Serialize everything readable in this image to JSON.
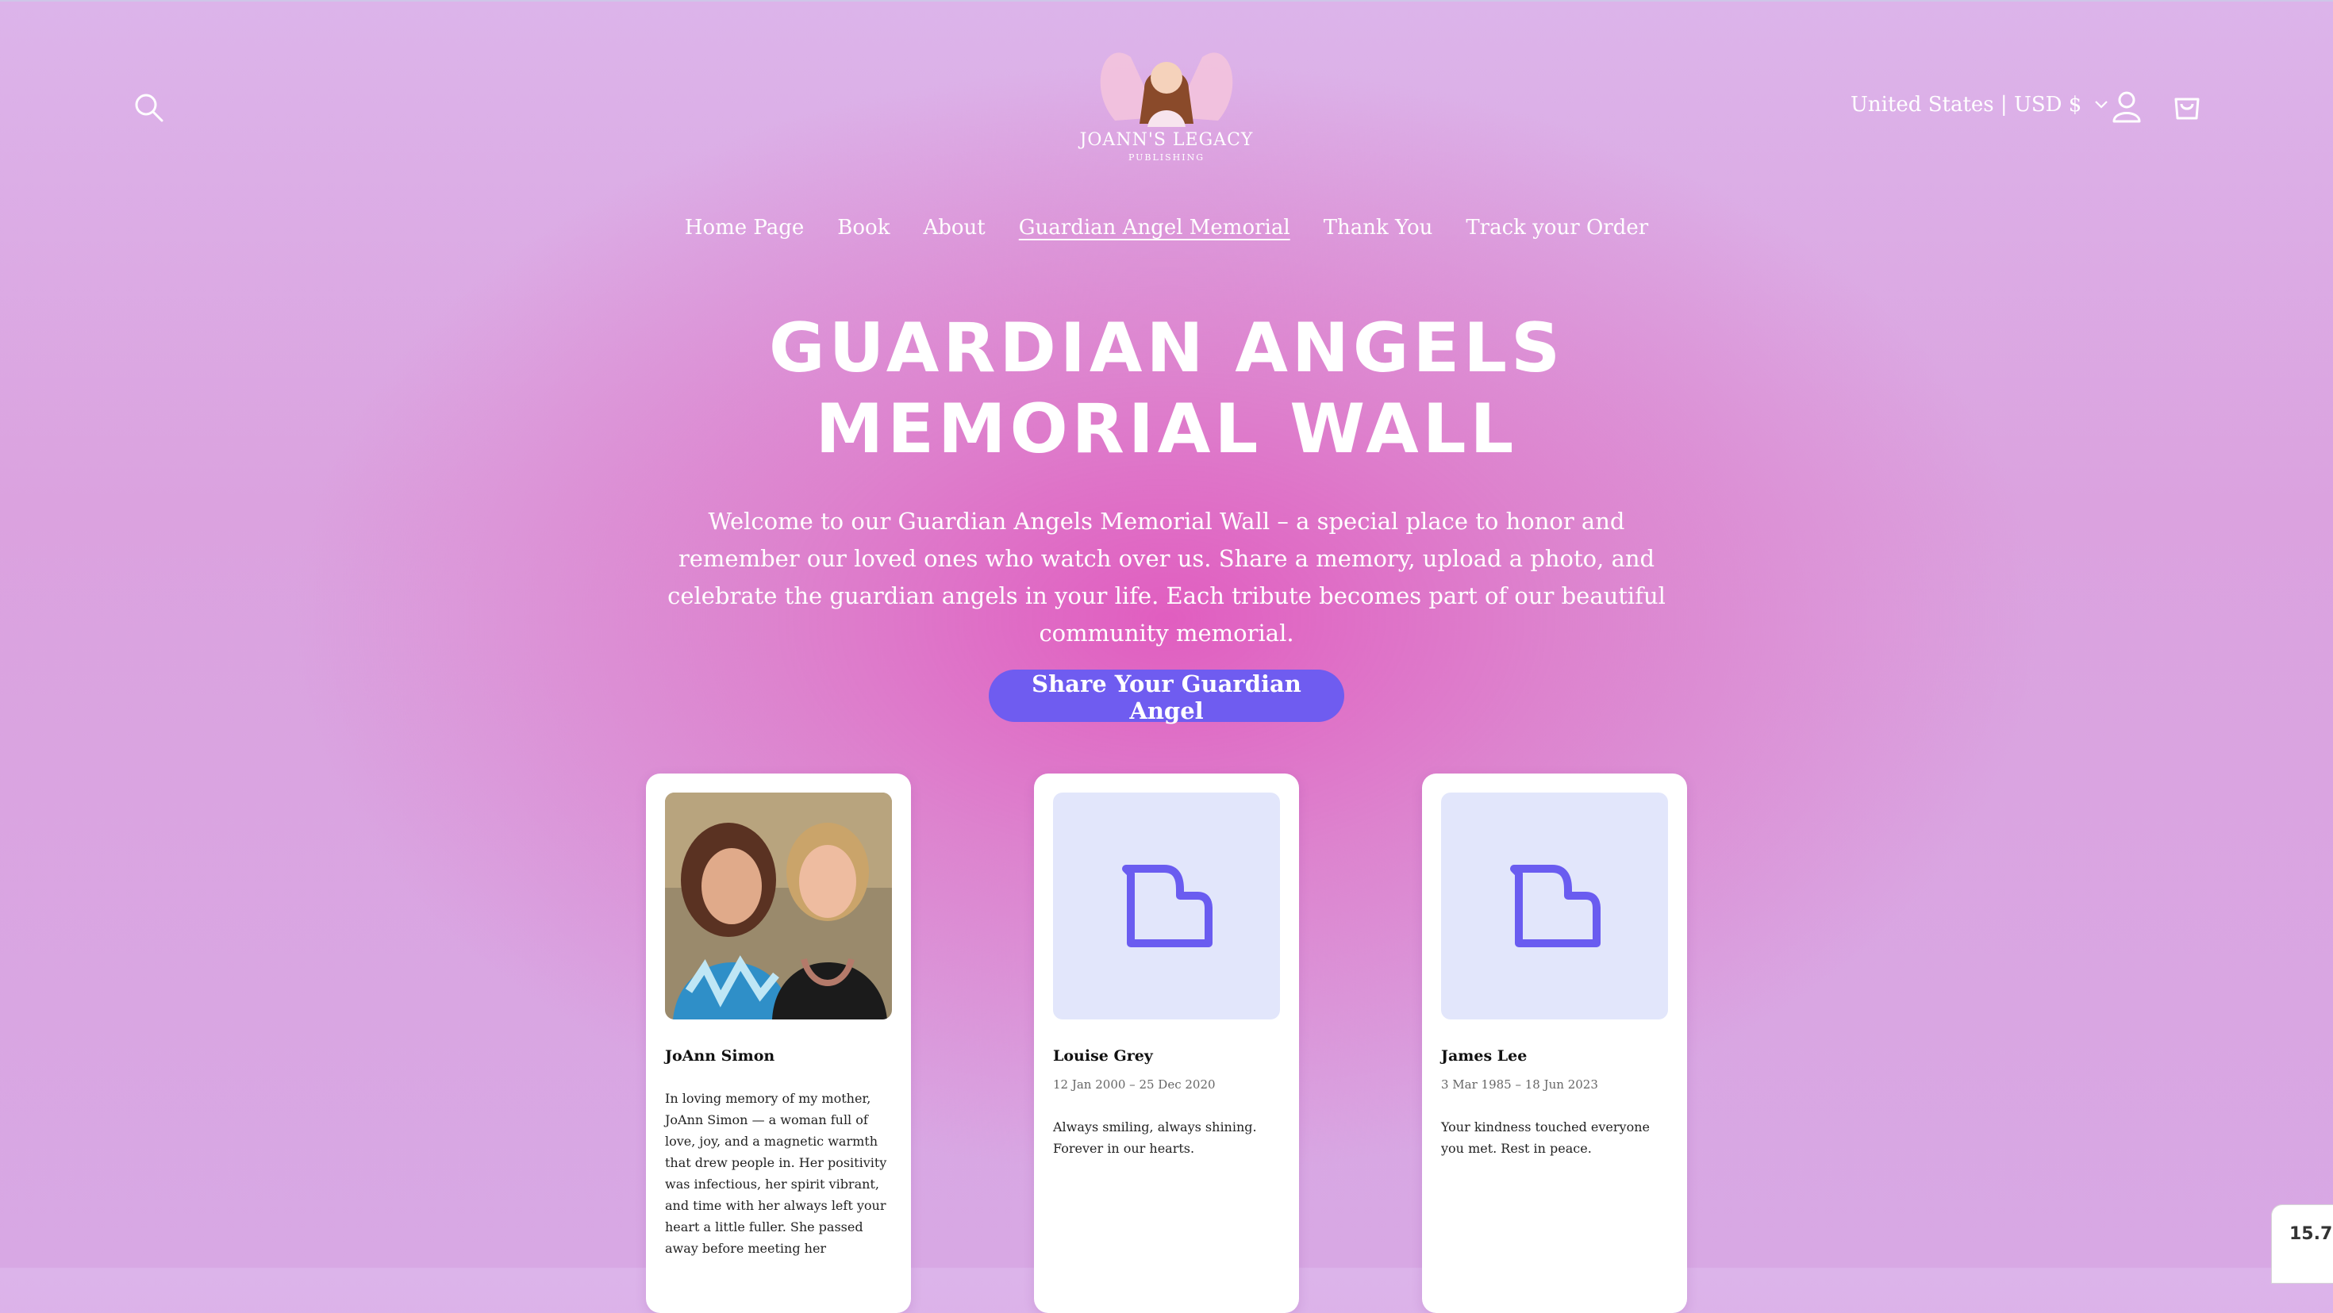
{
  "header": {
    "logo_text": "JOANN'S LEGACY",
    "logo_subtext": "PUBLISHING",
    "locale": "United States | USD $",
    "icons": {
      "search": "search-icon",
      "account": "user-icon",
      "cart": "cart-icon",
      "locale_chevron": "chevron-down-icon"
    }
  },
  "nav": {
    "items": [
      {
        "label": "Home Page"
      },
      {
        "label": "Book"
      },
      {
        "label": "About"
      },
      {
        "label": "Guardian Angel Memorial",
        "active": true
      },
      {
        "label": "Thank You"
      },
      {
        "label": "Track your Order"
      }
    ]
  },
  "hero": {
    "title_line1": "GUARDIAN ANGELS",
    "title_line2": "MEMORIAL WALL",
    "intro": "Welcome to our Guardian Angels Memorial Wall – a special place to honor and remember our loved ones who watch over us. Share a memory, upload a photo, and celebrate the guardian angels in your life. Each tribute becomes part of our beautiful community memorial.",
    "cta_label": "Share Your Guardian Angel"
  },
  "memorials": [
    {
      "name": "JoAnn Simon",
      "dates": "",
      "message": "In loving memory of my mother, JoAnn Simon — a woman full of love, joy, and a magnetic warmth that drew people in. Her positivity was infectious, her spirit vibrant, and time with her always left your heart a little fuller. She passed away before meeting her",
      "photo": "photo"
    },
    {
      "name": "Louise Grey",
      "dates": "12 Jan 2000 – 25 Dec 2020",
      "message": "Always smiling, always shining. Forever in our hearts.",
      "photo": "placeholder-image-icon"
    },
    {
      "name": "James Lee",
      "dates": "3 Mar 1985 – 18 Jun 2023",
      "message": "Your kindness touched everyone you met. Rest in peace.",
      "photo": "placeholder-image-icon"
    }
  ],
  "zoom_badge": "15.7",
  "colors": {
    "accent": "#6f5cf0",
    "placeholder_bg": "#e2e6fb",
    "text_light": "#ffffff"
  }
}
